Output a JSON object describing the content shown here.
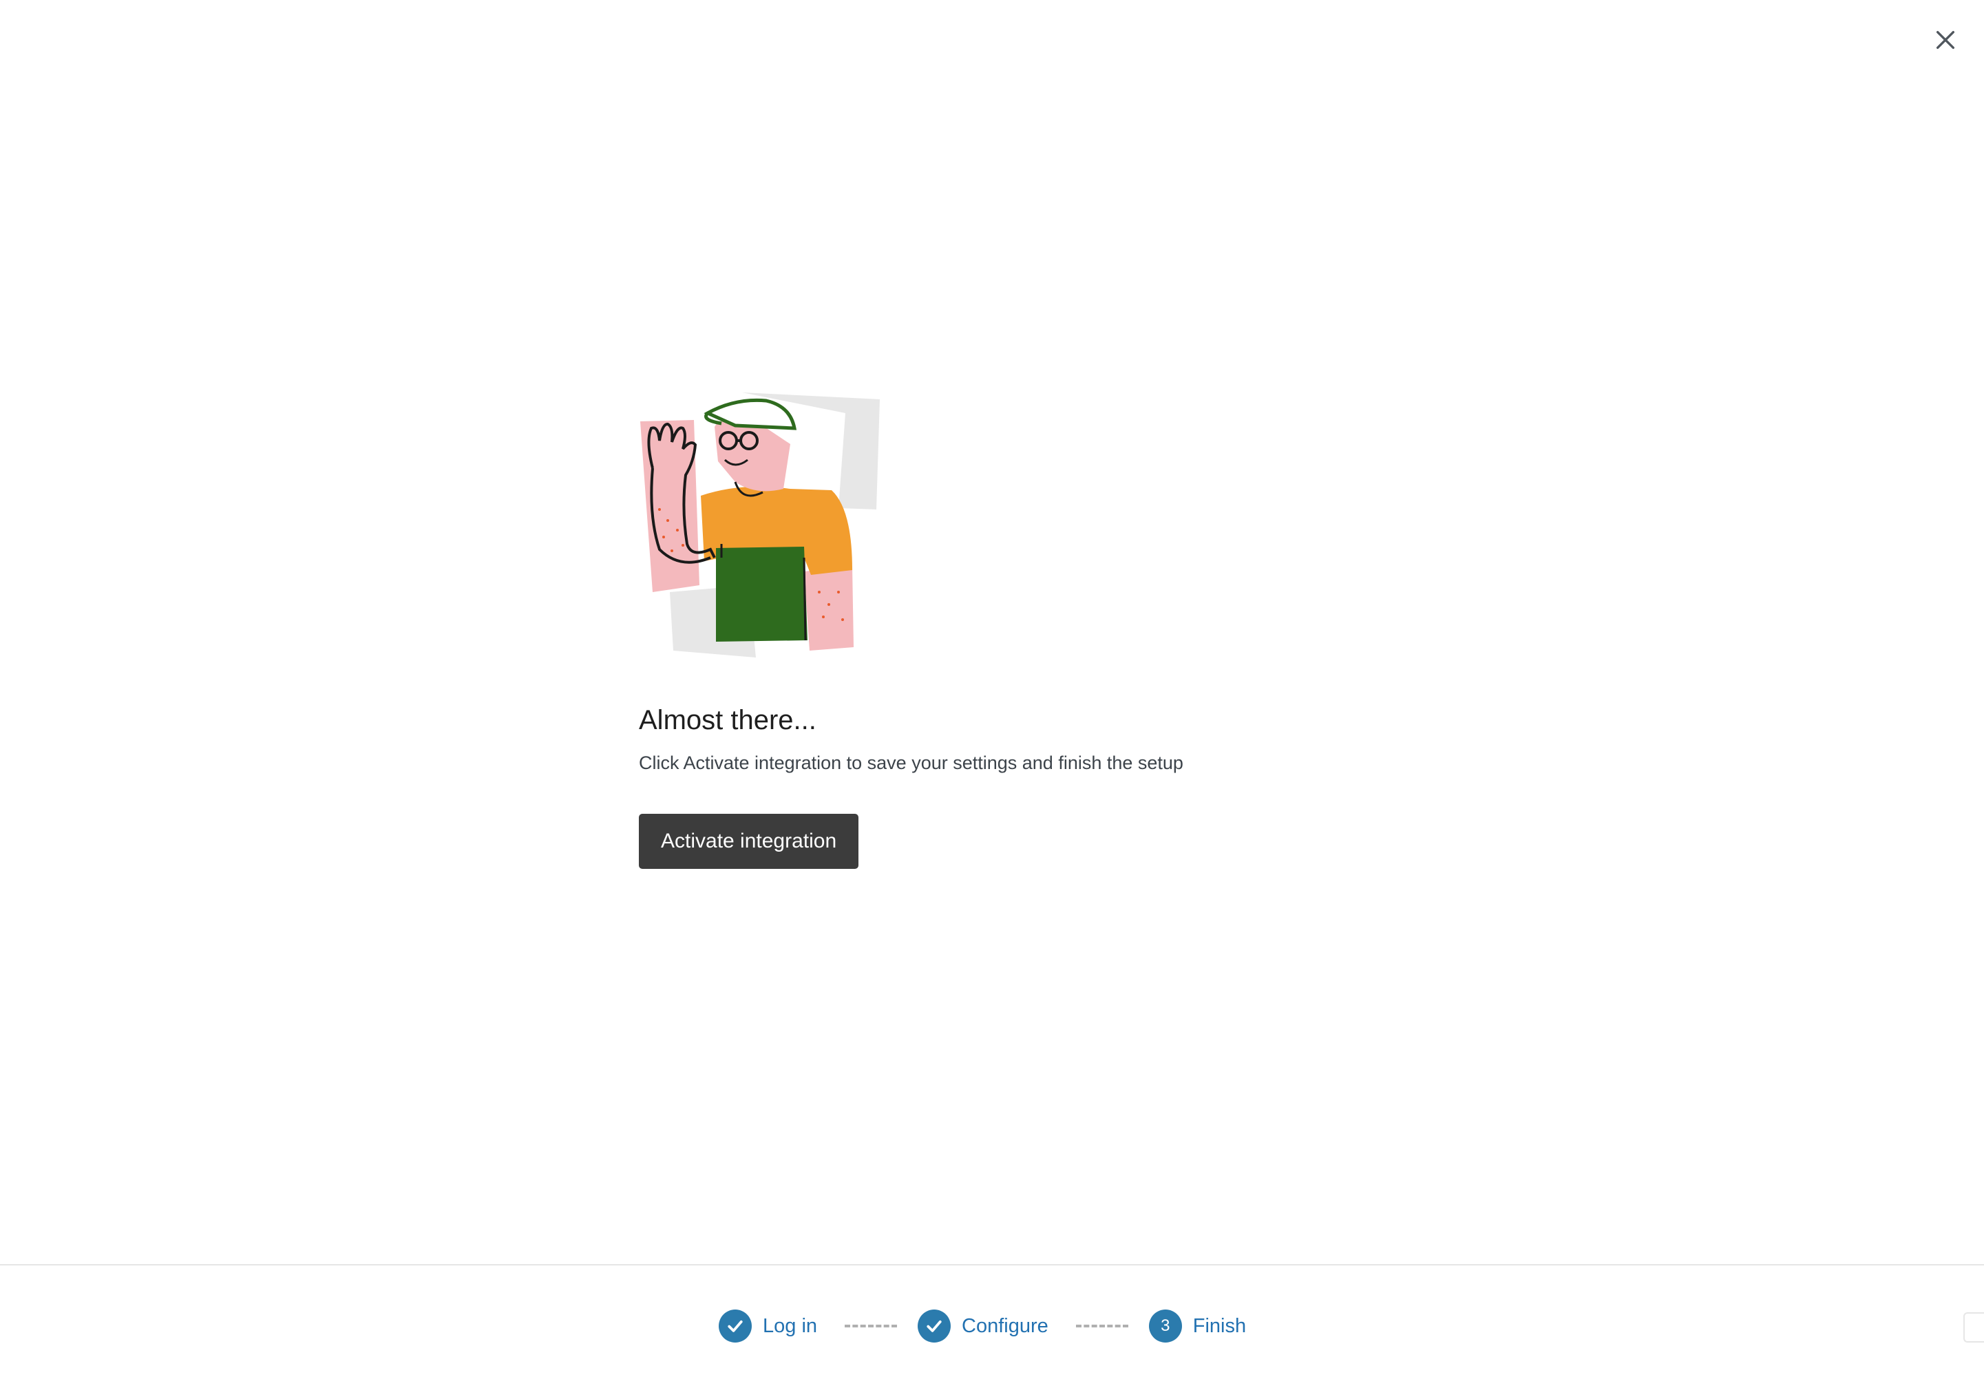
{
  "dialog": {
    "close_icon": "close-icon"
  },
  "main": {
    "illustration": "person-waving-illustration",
    "title": "Almost there...",
    "subtitle": "Click Activate integration to save your settings and finish the setup",
    "activate_button_label": "Activate integration"
  },
  "stepper": {
    "steps": [
      {
        "label": "Log in",
        "state": "completed",
        "icon": "checkmark-icon"
      },
      {
        "label": "Configure",
        "state": "completed",
        "icon": "checkmark-icon"
      },
      {
        "label": "Finish",
        "state": "current",
        "number": "3"
      }
    ]
  },
  "colors": {
    "accent": "#2b7bad",
    "link": "#2271b1",
    "button_bg": "#3c3c3c"
  }
}
